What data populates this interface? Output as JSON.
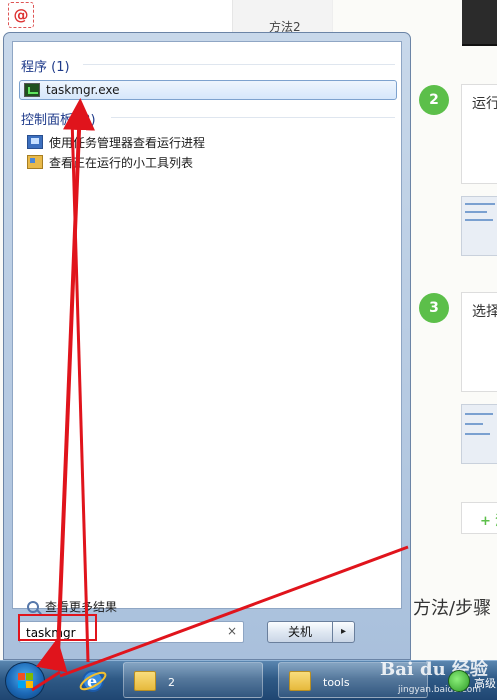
{
  "background_page": {
    "top_tab_label": "方法2",
    "steps": [
      {
        "number": "2",
        "text": "运行"
      },
      {
        "number": "3",
        "text": "选择"
      }
    ],
    "add_label": "+ 添",
    "method_section_title": "方法/步骤"
  },
  "start_menu": {
    "groups": [
      {
        "header": "程序 (1)",
        "items": [
          {
            "label": "taskmgr.exe",
            "icon": "task-manager-icon",
            "selected": true
          }
        ]
      },
      {
        "header": "控制面板 (2)",
        "items": [
          {
            "label": "使用任务管理器查看运行进程",
            "icon": "monitor-icon"
          },
          {
            "label": "查看正在运行的小工具列表",
            "icon": "gadget-icon"
          }
        ]
      }
    ],
    "see_more": "查看更多结果",
    "search": {
      "value": "taskmgr",
      "clear": "×"
    },
    "shutdown": {
      "label": "关机",
      "arrow": "▸"
    }
  },
  "taskbar": {
    "buttons": [
      {
        "label": "2",
        "icon": "folder-icon"
      },
      {
        "label": "tools",
        "icon": "folder-icon"
      }
    ],
    "tray_label": "高级",
    "watermark": "Bai du 经验",
    "watermark_sub": "jingyan.baidu.com"
  },
  "colors": {
    "accent_green": "#5cbf4a",
    "annotation_red": "#e0141c",
    "group_header_blue": "#1e3a8a"
  }
}
